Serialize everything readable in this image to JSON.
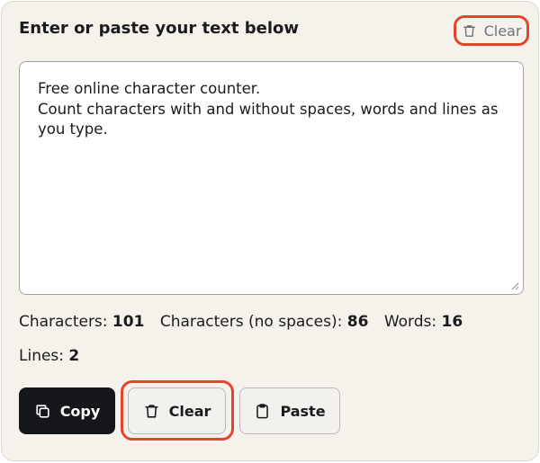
{
  "header": {
    "title": "Enter or paste your text below",
    "clear_label": "Clear"
  },
  "editor": {
    "text": "Free online character counter.\nCount characters with and without spaces, words and lines as you type."
  },
  "stats": {
    "characters_label": "Characters:",
    "characters_value": "101",
    "no_spaces_label": "Characters (no spaces):",
    "no_spaces_value": "86",
    "words_label": "Words:",
    "words_value": "16",
    "lines_label": "Lines:",
    "lines_value": "2"
  },
  "actions": {
    "copy_label": "Copy",
    "clear_label": "Clear",
    "paste_label": "Paste"
  },
  "icons": {
    "clear": "trash-icon",
    "copy": "copy-icon",
    "paste": "clipboard-icon"
  },
  "colors": {
    "highlight": "#e5442f",
    "primary_button": "#14161a",
    "panel_bg": "#f5f2ec"
  }
}
